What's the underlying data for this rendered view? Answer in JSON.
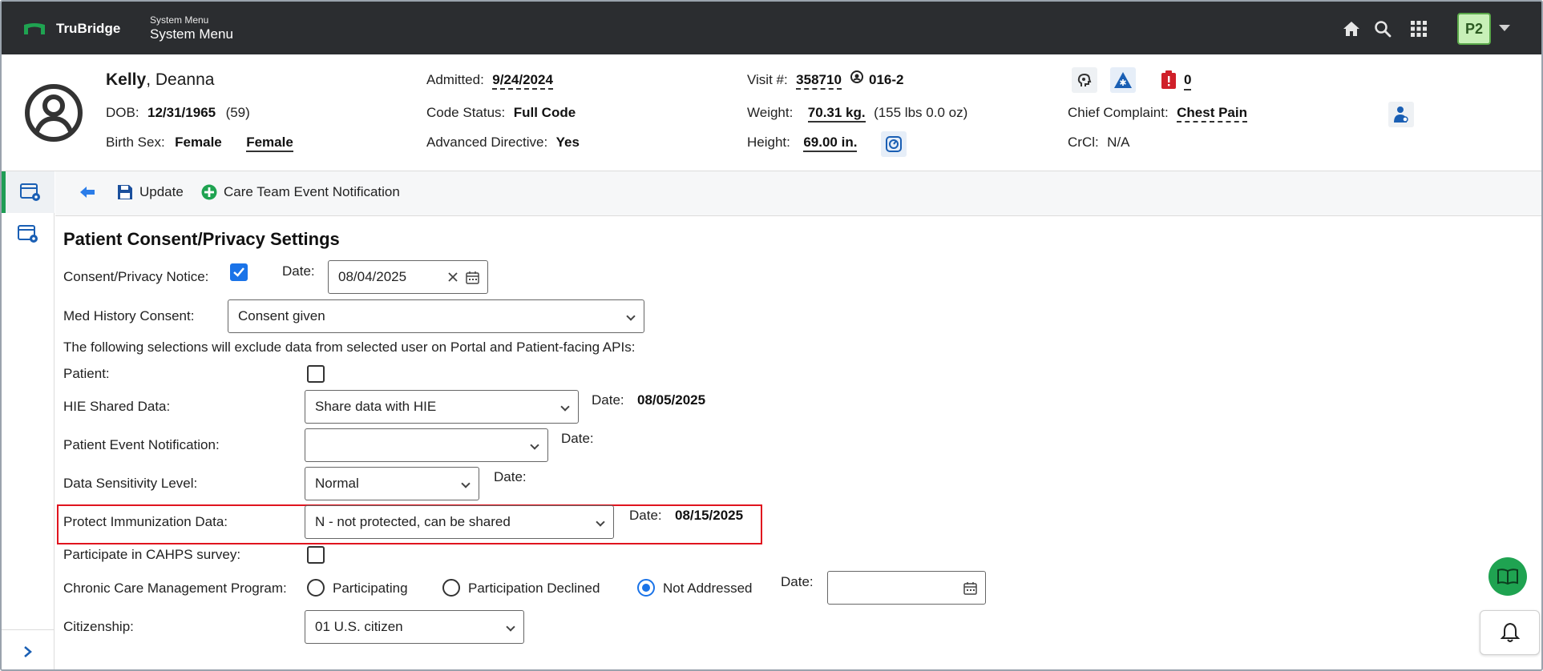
{
  "topbar": {
    "brand": "TruBridge",
    "system_menu_small": "System Menu",
    "system_menu_big": "System Menu",
    "user_badge": "P2",
    "icons": [
      "home-icon",
      "search-icon",
      "apps-grid-icon",
      "chevron-down-icon"
    ]
  },
  "patient": {
    "last_name": "Kelly",
    "first_name": ", Deanna",
    "dob_label": "DOB:",
    "dob": "12/31/1965",
    "age": "(59)",
    "birth_sex_label": "Birth Sex:",
    "birth_sex": "Female",
    "gender": "Female",
    "admitted_label": "Admitted:",
    "admitted": "9/24/2024",
    "code_status_label": "Code Status:",
    "code_status": "Full Code",
    "advanced_directive_label": "Advanced Directive:",
    "advanced_directive": "Yes",
    "visit_label": "Visit #:",
    "visit": "358710",
    "room": "016-2",
    "weight_label": "Weight:",
    "weight": "70.31 kg.",
    "weight_lbs": "(155 lbs 0.0 oz)",
    "height_label": "Height:",
    "height": "69.00 in.",
    "alerts_count": "0",
    "chief_complaint_label": "Chief Complaint:",
    "chief_complaint": "Chest Pain",
    "crcl_label": "CrCl:",
    "crcl": "N/A"
  },
  "toolbar": {
    "update_label": "Update",
    "care_team_label": "Care Team Event Notification"
  },
  "form": {
    "title": "Patient Consent/Privacy Settings",
    "consent_notice_label": "Consent/Privacy Notice:",
    "consent_notice_checked": true,
    "date_label": "Date:",
    "consent_date": "08/04/2025",
    "med_history_label": "Med History Consent:",
    "med_history_value": "Consent given",
    "exclusion_note": "The following selections will exclude data from selected user on Portal and Patient-facing APIs:",
    "patient_label": "Patient:",
    "hie_label": "HIE Shared Data:",
    "hie_value": "Share data with HIE",
    "hie_date": "08/05/2025",
    "event_notification_label": "Patient Event Notification:",
    "event_notification_value": "",
    "sensitivity_label": "Data Sensitivity Level:",
    "sensitivity_value": "Normal",
    "immunization_label": "Protect Immunization Data:",
    "immunization_value": "N - not protected, can be shared",
    "immunization_date": "08/15/2025",
    "cahps_label": "Participate in CAHPS survey:",
    "ccm_label": "Chronic Care Management Program:",
    "ccm_options": [
      "Participating",
      "Participation Declined",
      "Not Addressed"
    ],
    "ccm_selected": "Not Addressed",
    "ccm_date": "",
    "citizenship_label": "Citizenship:",
    "citizenship_value": "01 U.S. citizen"
  },
  "colors": {
    "topbar_bg": "#2b2d30",
    "accent_green": "#1f9d55",
    "accent_blue": "#1a73e8",
    "highlight_red": "#e0141e"
  }
}
